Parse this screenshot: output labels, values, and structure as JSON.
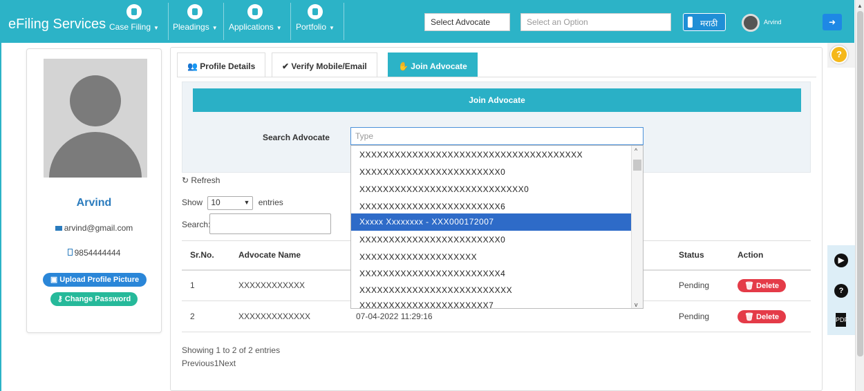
{
  "app": {
    "brand": "eFiling Services"
  },
  "nav": [
    {
      "label": "Case Filing"
    },
    {
      "label": "Pleadings"
    },
    {
      "label": "Applications"
    },
    {
      "label": "Portfolio"
    }
  ],
  "header": {
    "select_advocate": "Select Advocate",
    "select_option_placeholder": "Select an Option",
    "language": "मराठी",
    "user": "Arvind"
  },
  "profile": {
    "name": "Arvind",
    "email": "arvind@gmail.com",
    "phone": "9854444444",
    "upload_label": "Upload Profile Picture",
    "password_label": "Change Password"
  },
  "tabs": [
    {
      "label": "Profile Details",
      "active": false
    },
    {
      "label": "Verify Mobile/Email",
      "active": false
    },
    {
      "label": "Join Advocate",
      "active": true
    }
  ],
  "join": {
    "header": "Join Advocate",
    "search_label": "Search Advocate",
    "search_value": "Type"
  },
  "dropdown": {
    "items": [
      "XXXXXXXXXXXXXXXXXXXXXXXXXXXXXXXXXXXXXX",
      "XXXXXXXXXXXXXXXXXXXXXXXX0",
      "XXXXXXXXXXXXXXXXXXXXXXXXXXXX0",
      "XXXXXXXXXXXXXXXXXXXXXXXX6",
      "Xxxxx Xxxxxxxx - XXX000172007",
      "XXXXXXXXXXXXXXXXXXXXXXXX0",
      "XXXXXXXXXXXXXXXXXXXX",
      "XXXXXXXXXXXXXXXXXXXXXXXX4",
      "XXXXXXXXXXXXXXXXXXXXXXXXXX",
      "XXXXXXXXXXXXXXXXXXXXXX7"
    ],
    "selected_index": 4
  },
  "table": {
    "refresh_label": "Refresh",
    "show_label": "Show",
    "entries_value": "10",
    "entries_label": "entries",
    "search_label": "Search:",
    "columns": [
      "Sr.No.",
      "Advocate Name",
      "",
      "Status",
      "Action"
    ],
    "rows": [
      {
        "sr": "1",
        "name": "XXXXXXXXXXXX",
        "date": "",
        "status": "Pending",
        "action": "Delete"
      },
      {
        "sr": "2",
        "name": "XXXXXXXXXXXXX",
        "date": "07-04-2022 11:29:16",
        "status": "Pending",
        "action": "Delete"
      }
    ],
    "info": "Showing 1 to 2 of 2 entries",
    "pager": "Previous1Next"
  },
  "colors": {
    "primary": "#2cb3c7",
    "danger": "#e43b48",
    "selected": "#2e6bc8",
    "link": "#2a7bbd"
  }
}
